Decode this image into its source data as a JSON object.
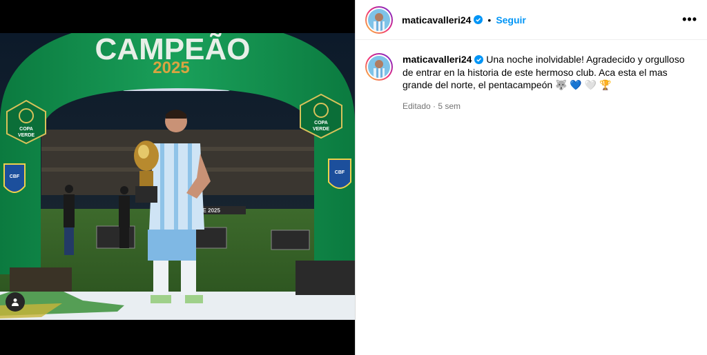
{
  "post": {
    "username": "maticavalleri24",
    "follow_label": "Seguir",
    "separator": "•",
    "more_label": "•••",
    "caption": "Una noche inolvidable! Agradecido y orgulloso de entrar en la historia de este hermoso club. Aca esta el mas grande del norte, el pentacampeón 🐺 💙 🤍 🏆",
    "meta": "Editado · 5 sem"
  },
  "photo": {
    "arch_title": "CAMPEÃO",
    "arch_year": "2025",
    "badge_line1": "COPA",
    "badge_line2": "VERDE",
    "cbf_label": "CBF",
    "board_text": "RDE 2025"
  },
  "icons": {
    "verified": "verified-badge-icon",
    "user_tag": "user-tag-icon",
    "more": "more-options-icon"
  },
  "colors": {
    "follow": "#0095f6",
    "verified": "#0095f6",
    "arch_green": "#0d8c4a"
  }
}
